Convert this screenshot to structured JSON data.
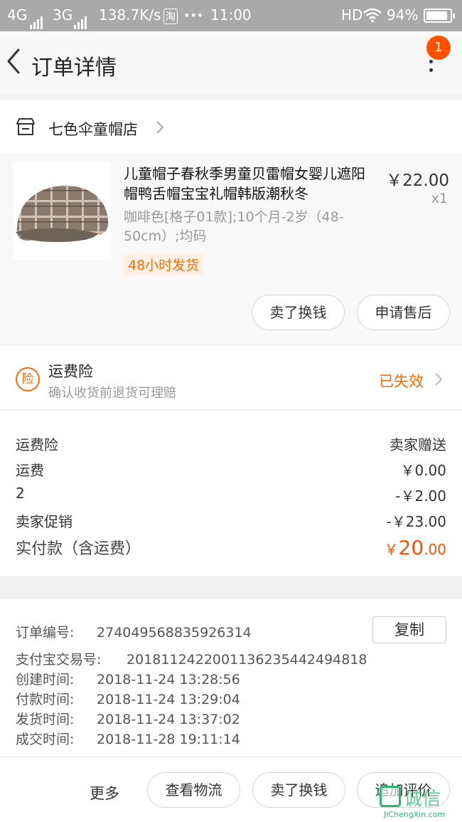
{
  "status_bar": {
    "net1": "4G",
    "net2": "3G",
    "speed": "138.7K/s",
    "app_badge": "淘",
    "dots": "•••",
    "time": "11:00",
    "hd": "HD",
    "battery": "94%",
    "icons": [
      "signal-icon",
      "wifi-icon",
      "battery-icon"
    ]
  },
  "header": {
    "title": "订单详情",
    "badge_count": "1",
    "icons": [
      "back-arrow-icon",
      "more-vertical-icon"
    ]
  },
  "store": {
    "name": "七色伞童帽店",
    "icon": "store-icon"
  },
  "product": {
    "title": "儿童帽子春秋季男童贝雷帽女婴儿遮阳帽鸭舌帽宝宝礼帽韩版潮秋冬",
    "price": "￥22.00",
    "quantity": "x1",
    "sku": "咖啡色[格子01款];10个月-2岁（48-50cm）;均码",
    "ship_tag": "48小时发货",
    "buttons": {
      "resell": "卖了换钱",
      "after_sale": "申请售后"
    }
  },
  "insurance": {
    "icon_label": "险",
    "title": "运费险",
    "subtitle": "确认收货前退货可理赔",
    "status": "已失效"
  },
  "fees": {
    "rows": [
      {
        "label": "运费险",
        "value": "卖家赠送"
      },
      {
        "label": "运费",
        "value": "￥0.00"
      },
      {
        "label": "2",
        "value": "-￥2.00"
      },
      {
        "label": "卖家促销",
        "value": "-￥23.00"
      }
    ],
    "paid_label": "实付款（含运费）",
    "paid_symbol": "￥",
    "paid_int": "20",
    "paid_dec": ".00"
  },
  "order_info": {
    "copy_label": "复制",
    "rows": [
      {
        "label": "订单编号:",
        "value": "274049568835926314"
      },
      {
        "label": "支付宝交易号:",
        "value": "2018112422001136235442494818"
      },
      {
        "label": "创建时间:",
        "value": "2018-11-24 13:28:56"
      },
      {
        "label": "付款时间:",
        "value": "2018-11-24 13:29:04"
      },
      {
        "label": "发货时间:",
        "value": "2018-11-24 13:37:02"
      },
      {
        "label": "成交时间:",
        "value": "2018-11-28 19:11:14"
      }
    ]
  },
  "actions": {
    "more": "更多",
    "logistics": "查看物流",
    "resell": "卖了换钱",
    "review": "追加评价"
  },
  "watermark": {
    "text": "诚信",
    "sub": "JiChengXin.com"
  },
  "colors": {
    "accent": "#ff5000",
    "orange": "#ff6a00",
    "status_bar": "#a9a9a9"
  }
}
